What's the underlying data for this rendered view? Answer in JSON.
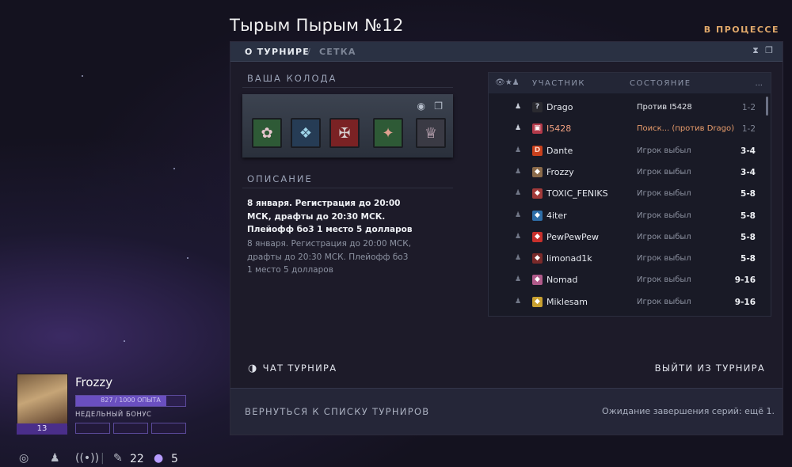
{
  "header": {
    "title": "Тырым Пырым №12",
    "status": "В ПРОЦЕССЕ",
    "status_color": "#e0a86a"
  },
  "tabs": {
    "active": "О ТУРНИРЕ",
    "separator": "/",
    "other": "СЕТКА"
  },
  "deck": {
    "heading": "ВАША КОЛОДА",
    "cards": [
      {
        "icon": "hero-card-1-icon",
        "bg": "#2e5a36"
      },
      {
        "icon": "hero-card-2-icon",
        "bg": "#263c55"
      },
      {
        "icon": "hero-card-3-icon",
        "bg": "#7a2224"
      },
      {
        "icon": "hero-card-4-icon",
        "bg": "#2e5a36"
      },
      {
        "icon": "hero-card-5-icon",
        "bg": "#3a3a44"
      }
    ]
  },
  "description": {
    "heading": "ОПИСАНИЕ",
    "text_bold": "8 января. Регистрация до 20:00 МСК, драфты до 20:30 МСК. Плейофф бо3 1 место 5 долларов",
    "text_gray": "8 января. Регистрация до 20:00 МСК, драфты до 20:30 МСК. Плейофф бо3 1 место 5 долларов"
  },
  "participants": {
    "col_participant": "УЧАСТНИК",
    "col_state": "СОСТОЯНИЕ",
    "col_more": "...",
    "rows": [
      {
        "name": "Drago",
        "avatar": "?",
        "avatar_bg": "#2a2a30",
        "state": "Против I5428",
        "style": "w",
        "place": "1-2",
        "dim": true,
        "highlight": false
      },
      {
        "name": "I5428",
        "avatar": "▣",
        "avatar_bg": "#b33a4a",
        "state": "Поиск... (против Drago)",
        "style": "o",
        "place": "1-2",
        "dim": true,
        "highlight": true
      },
      {
        "name": "Dante",
        "avatar": "D",
        "avatar_bg": "#c8401c",
        "state": "Игрок выбыл",
        "style": "",
        "place": "3-4",
        "dim": false,
        "highlight": false
      },
      {
        "name": "Frozzy",
        "avatar": "◆",
        "avatar_bg": "#8a6a4a",
        "state": "Игрок выбыл",
        "style": "",
        "place": "3-4",
        "dim": false,
        "highlight": false
      },
      {
        "name": "TOXIC_FENIKS",
        "avatar": "◆",
        "avatar_bg": "#a23a3a",
        "state": "Игрок выбыл",
        "style": "",
        "place": "5-8",
        "dim": false,
        "highlight": false
      },
      {
        "name": "4iter",
        "avatar": "◆",
        "avatar_bg": "#2e6ea8",
        "state": "Игрок выбыл",
        "style": "",
        "place": "5-8",
        "dim": false,
        "highlight": false
      },
      {
        "name": "PewPewPew",
        "avatar": "◆",
        "avatar_bg": "#c8302c",
        "state": "Игрок выбыл",
        "style": "",
        "place": "5-8",
        "dim": false,
        "highlight": false
      },
      {
        "name": "limonad1k",
        "avatar": "◆",
        "avatar_bg": "#7a2a2a",
        "state": "Игрок выбыл",
        "style": "",
        "place": "5-8",
        "dim": false,
        "highlight": false
      },
      {
        "name": "Nomad",
        "avatar": "◆",
        "avatar_bg": "#b05a8a",
        "state": "Игрок выбыл",
        "style": "",
        "place": "9-16",
        "dim": false,
        "highlight": false
      },
      {
        "name": "Miklesam",
        "avatar": "◆",
        "avatar_bg": "#c8a030",
        "state": "Игрок выбыл",
        "style": "",
        "place": "9-16",
        "dim": false,
        "highlight": false
      }
    ]
  },
  "actions": {
    "chat": "ЧАТ ТУРНИРА",
    "leave": "ВЫЙТИ ИЗ ТУРНИРА"
  },
  "footer": {
    "back": "ВЕРНУТЬСЯ К СПИСКУ ТУРНИРОВ",
    "waiting": "Ожидание завершения серий: ещё 1."
  },
  "profile": {
    "name": "Frozzy",
    "level": "13",
    "xp_text": "827 / 1000 ОПЫТА",
    "xp_fraction": 0.827,
    "weekly_label": "НЕДЕЛЬНЫЙ БОНУС"
  },
  "bottom_bar": {
    "count_1": "22",
    "count_2": "5"
  }
}
